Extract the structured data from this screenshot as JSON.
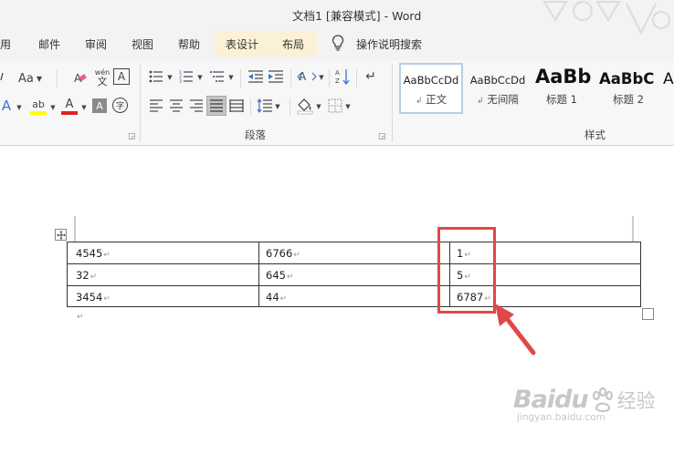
{
  "window": {
    "title": "文档1 [兼容模式]  -  Word"
  },
  "tabs": [
    {
      "label": "用",
      "name": "tab-partial-reference"
    },
    {
      "label": "邮件",
      "name": "tab-mailings"
    },
    {
      "label": "审阅",
      "name": "tab-review"
    },
    {
      "label": "视图",
      "name": "tab-view"
    },
    {
      "label": "帮助",
      "name": "tab-help"
    },
    {
      "label": "表设计",
      "name": "tab-table-design"
    },
    {
      "label": "布局",
      "name": "tab-layout"
    }
  ],
  "tell_me": {
    "label": "操作说明搜索",
    "icon": "lightbulb-icon"
  },
  "ribbon": {
    "font_group": {
      "font_size_label": "Aa",
      "phonetic_label": "wén",
      "phonetic_sub": "文",
      "border_char": "A",
      "effects_label": "A",
      "highlight_label": "ab",
      "font_color_label": "A",
      "shading_label": "A",
      "enclose_label": "字",
      "highlight_color": "#ffff00",
      "font_color_color": "#e02020"
    },
    "paragraph_group": {
      "label": "段落"
    },
    "styles_group": {
      "label": "样式",
      "items": [
        {
          "sample": "AaBbCcDd",
          "name": "正文",
          "mark": "↲",
          "selected": true
        },
        {
          "sample": "AaBbCcDd",
          "name": "无间隔",
          "mark": "↲",
          "selected": false
        },
        {
          "sample": "AaBb",
          "name": "标题 1",
          "selected": false
        },
        {
          "sample": "AaBbC",
          "name": "标题 2",
          "selected": false
        },
        {
          "sample": "A",
          "name": "",
          "selected": false
        }
      ]
    }
  },
  "table": {
    "rows": [
      [
        "4545",
        "6766",
        "1"
      ],
      [
        "32",
        "645",
        "5"
      ],
      [
        "3454",
        "44",
        "6787"
      ]
    ],
    "paragraph_mark": "↵",
    "highlight_color": "#e04848"
  },
  "watermark": {
    "brand": "Baidu",
    "cn": "经验",
    "url": "jingyan.baidu.com"
  }
}
